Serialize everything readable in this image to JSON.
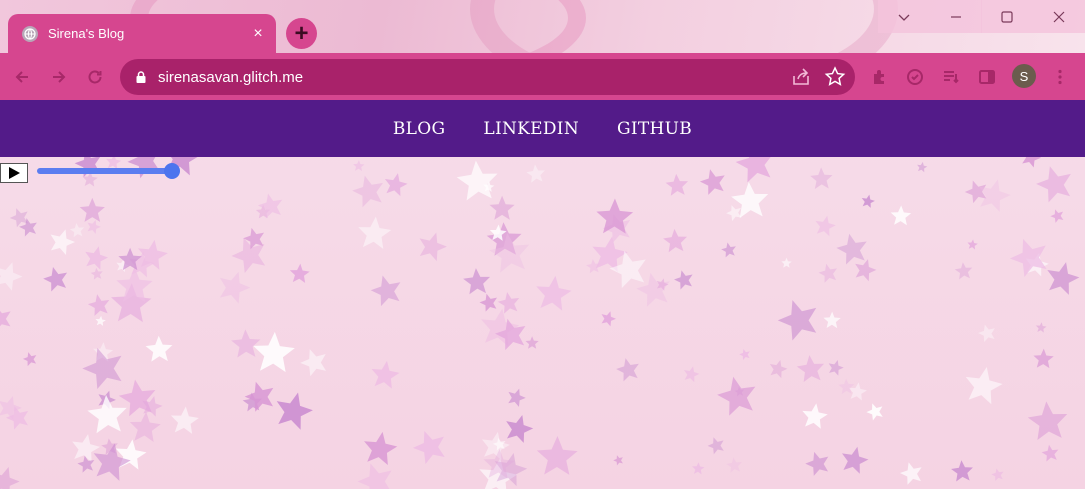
{
  "browser": {
    "tab_title": "Sirena's Blog",
    "tab_close_icon": "×",
    "new_tab_icon": "+",
    "url": "sirenasavan.glitch.me",
    "profile_initial": "S"
  },
  "nav": {
    "items": [
      {
        "label": "BLOG"
      },
      {
        "label": "LINKEDIN"
      },
      {
        "label": "GITHUB"
      }
    ]
  },
  "audio_player": {
    "volume": 1.0
  },
  "colors": {
    "tab": "#d6468f",
    "omnibox": "#a9226a",
    "nav_bar": "#531b89",
    "page_bg": "#f6dce9"
  }
}
